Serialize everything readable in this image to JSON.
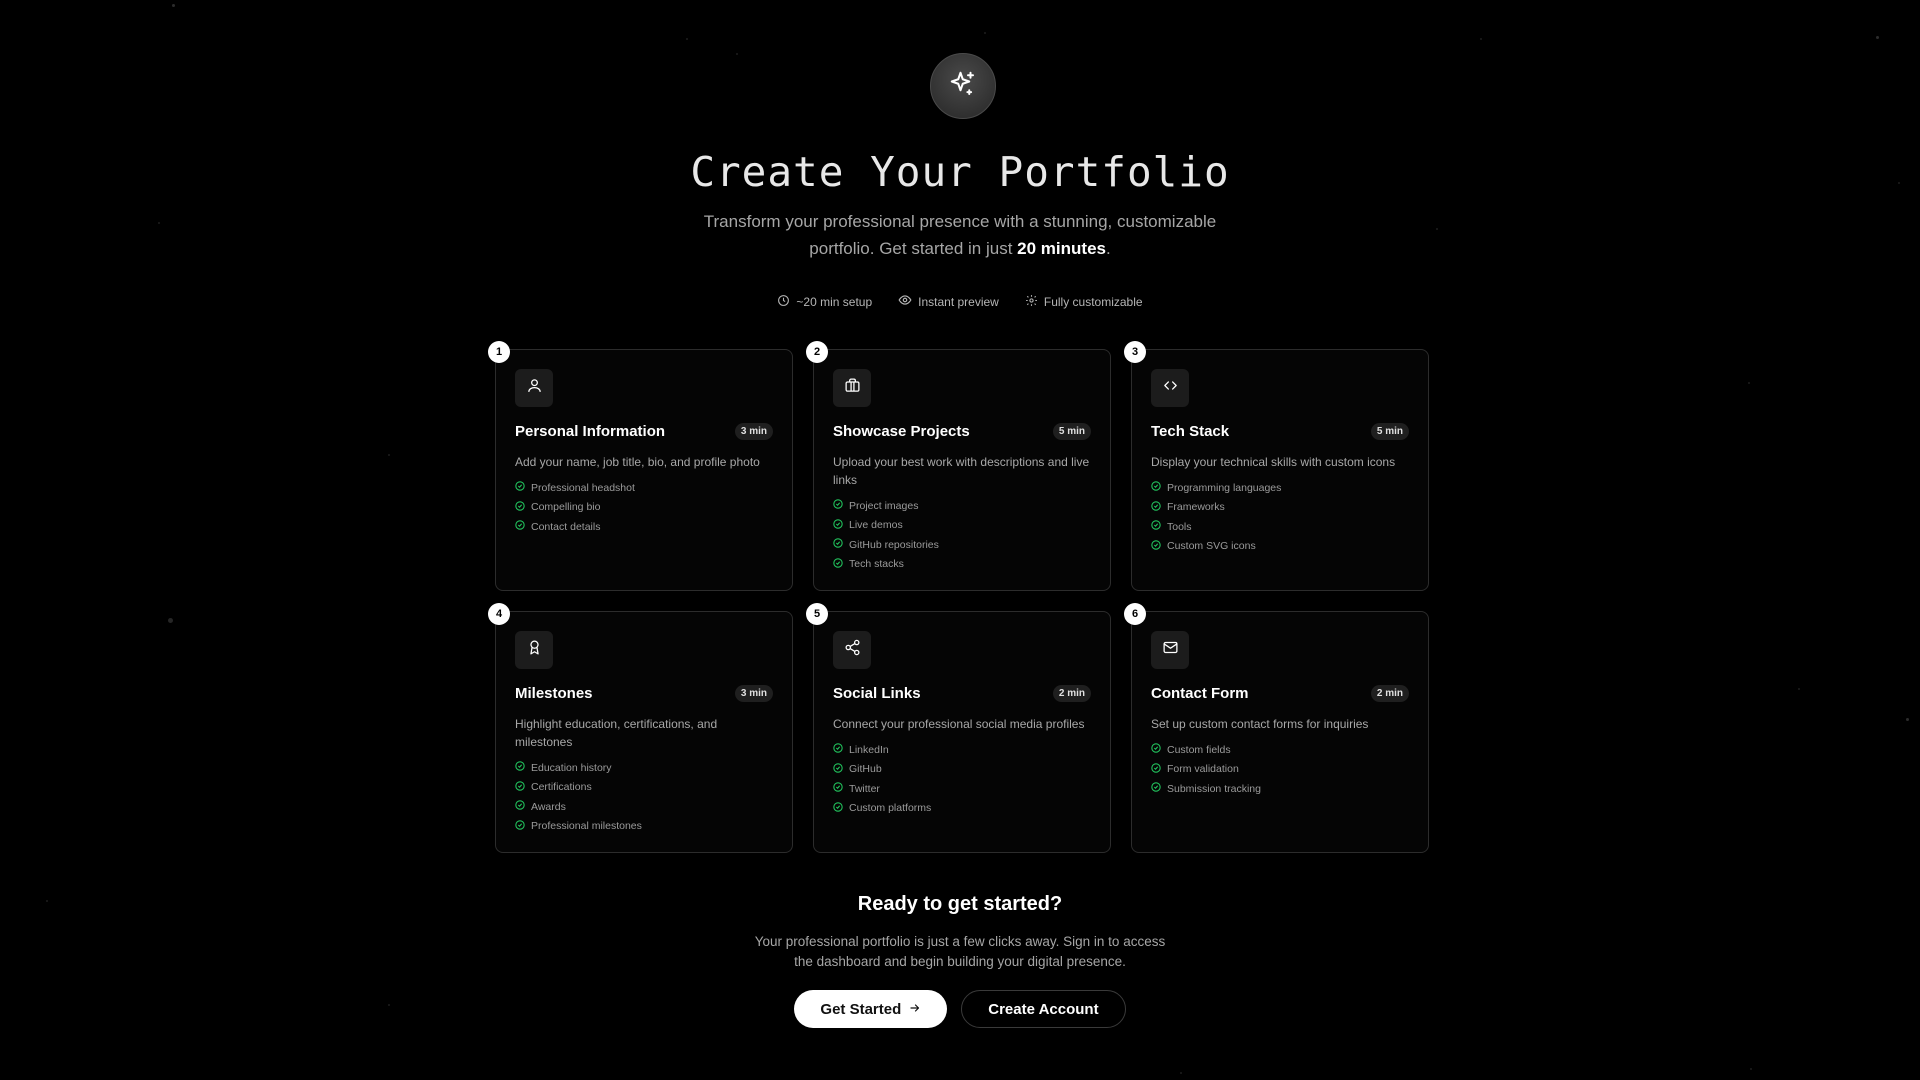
{
  "hero": {
    "icon": "sparkles-icon",
    "title": "Create Your Portfolio",
    "subtitle_lead": "Transform your professional presence with a stunning, customizable portfolio. Get started in just",
    "subtitle_emphasis": "20 minutes",
    "subtitle_tail": "."
  },
  "meta": [
    {
      "icon": "clock-icon",
      "label": "~20 min setup"
    },
    {
      "icon": "eye-icon",
      "label": "Instant preview"
    },
    {
      "icon": "gear-icon",
      "label": "Fully customizable"
    }
  ],
  "steps": [
    {
      "number": "1",
      "icon": "user-icon",
      "title": "Personal Information",
      "time": "3 min",
      "description": "Add your name, job title, bio, and profile photo",
      "features": [
        "Professional headshot",
        "Compelling bio",
        "Contact details"
      ]
    },
    {
      "number": "2",
      "icon": "briefcase-icon",
      "title": "Showcase Projects",
      "time": "5 min",
      "description": "Upload your best work with descriptions and live links",
      "features": [
        "Project images",
        "Live demos",
        "GitHub repositories",
        "Tech stacks"
      ]
    },
    {
      "number": "3",
      "icon": "code-icon",
      "title": "Tech Stack",
      "time": "5 min",
      "description": "Display your technical skills with custom icons",
      "features": [
        "Programming languages",
        "Frameworks",
        "Tools",
        "Custom SVG icons"
      ]
    },
    {
      "number": "4",
      "icon": "award-icon",
      "title": "Milestones",
      "time": "3 min",
      "description": "Highlight education, certifications, and milestones",
      "features": [
        "Education history",
        "Certifications",
        "Awards",
        "Professional milestones"
      ]
    },
    {
      "number": "5",
      "icon": "share-icon",
      "title": "Social Links",
      "time": "2 min",
      "description": "Connect your professional social media profiles",
      "features": [
        "LinkedIn",
        "GitHub",
        "Twitter",
        "Custom platforms"
      ]
    },
    {
      "number": "6",
      "icon": "mail-icon",
      "title": "Contact Form",
      "time": "2 min",
      "description": "Set up custom contact forms for inquiries",
      "features": [
        "Custom fields",
        "Form validation",
        "Submission tracking"
      ]
    }
  ],
  "cta": {
    "title": "Ready to get started?",
    "text": "Your professional portfolio is just a few clicks away. Sign in to access the dashboard and begin building your digital presence.",
    "primary_label": "Get Started",
    "primary_icon": "arrow-right-icon",
    "secondary_label": "Create Account"
  },
  "colors": {
    "background": "#000000",
    "card_border": "#2c2c2c",
    "check_green": "#22c55e",
    "text_muted": "#a6a6a6"
  }
}
